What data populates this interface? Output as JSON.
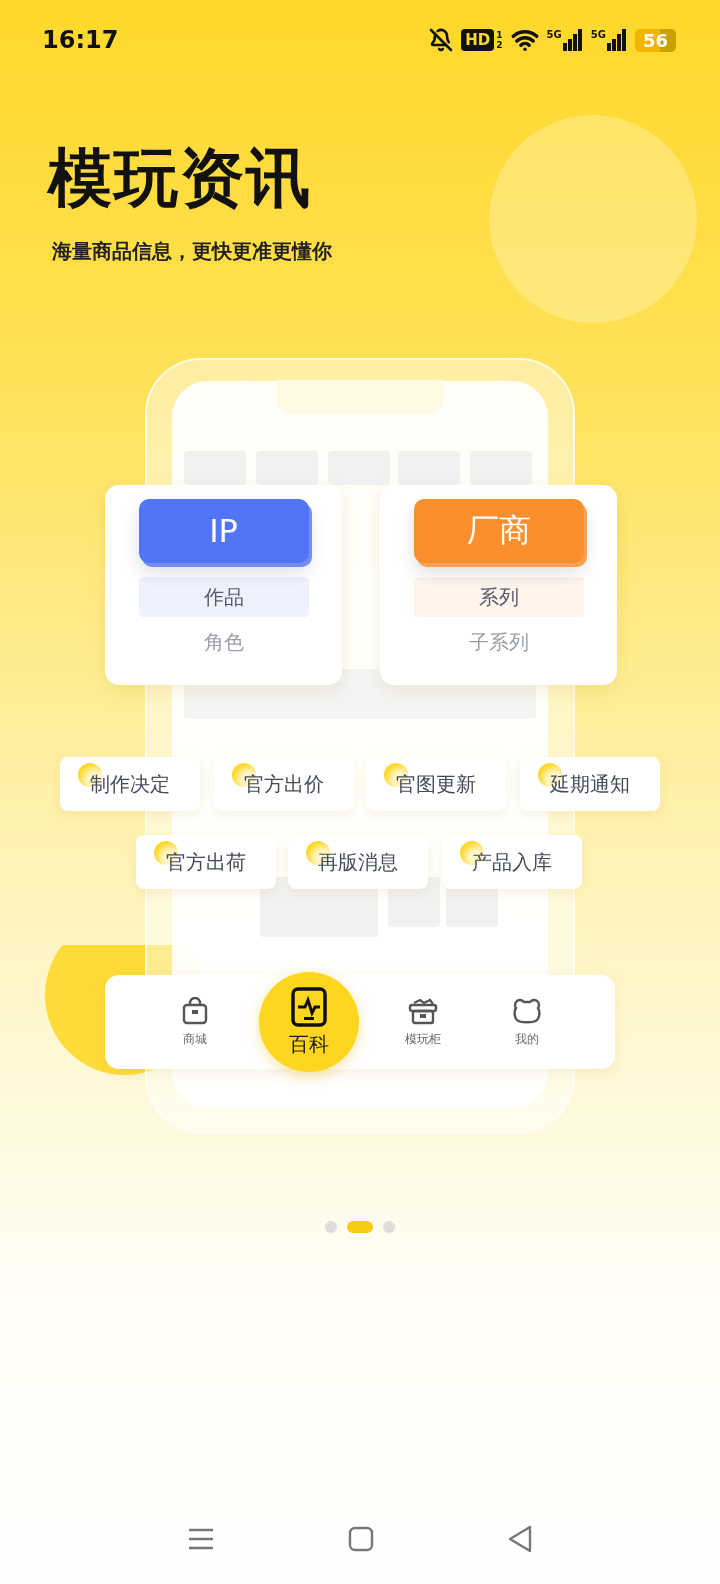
{
  "status_bar": {
    "time": "16:17",
    "hd": "HD",
    "hd_sims": [
      "1",
      "2"
    ],
    "signals": [
      "5G",
      "5G"
    ],
    "battery": "56"
  },
  "title": "模玩资讯",
  "subtitle": "海量商品信息，更快更准更懂你",
  "categories": [
    {
      "label": "IP",
      "color": "#5274f7",
      "items": [
        "作品",
        "角色"
      ]
    },
    {
      "label": "厂商",
      "color": "#fb8f2e",
      "items": [
        "系列",
        "子系列"
      ]
    }
  ],
  "tag_rows": [
    [
      "制作决定",
      "官方出价",
      "官图更新",
      "延期通知"
    ],
    [
      "官方出荷",
      "再版消息",
      "产品入库"
    ]
  ],
  "nav": [
    {
      "label": "商城",
      "kind": "bag",
      "selected": false
    },
    {
      "label": "百科",
      "kind": "monitor",
      "selected": true
    },
    {
      "label": "模玩柜",
      "kind": "box",
      "selected": false
    },
    {
      "label": "我的",
      "kind": "bear",
      "selected": false
    }
  ],
  "pager": [
    {
      "selected": false
    },
    {
      "selected": true
    },
    {
      "selected": false
    }
  ]
}
